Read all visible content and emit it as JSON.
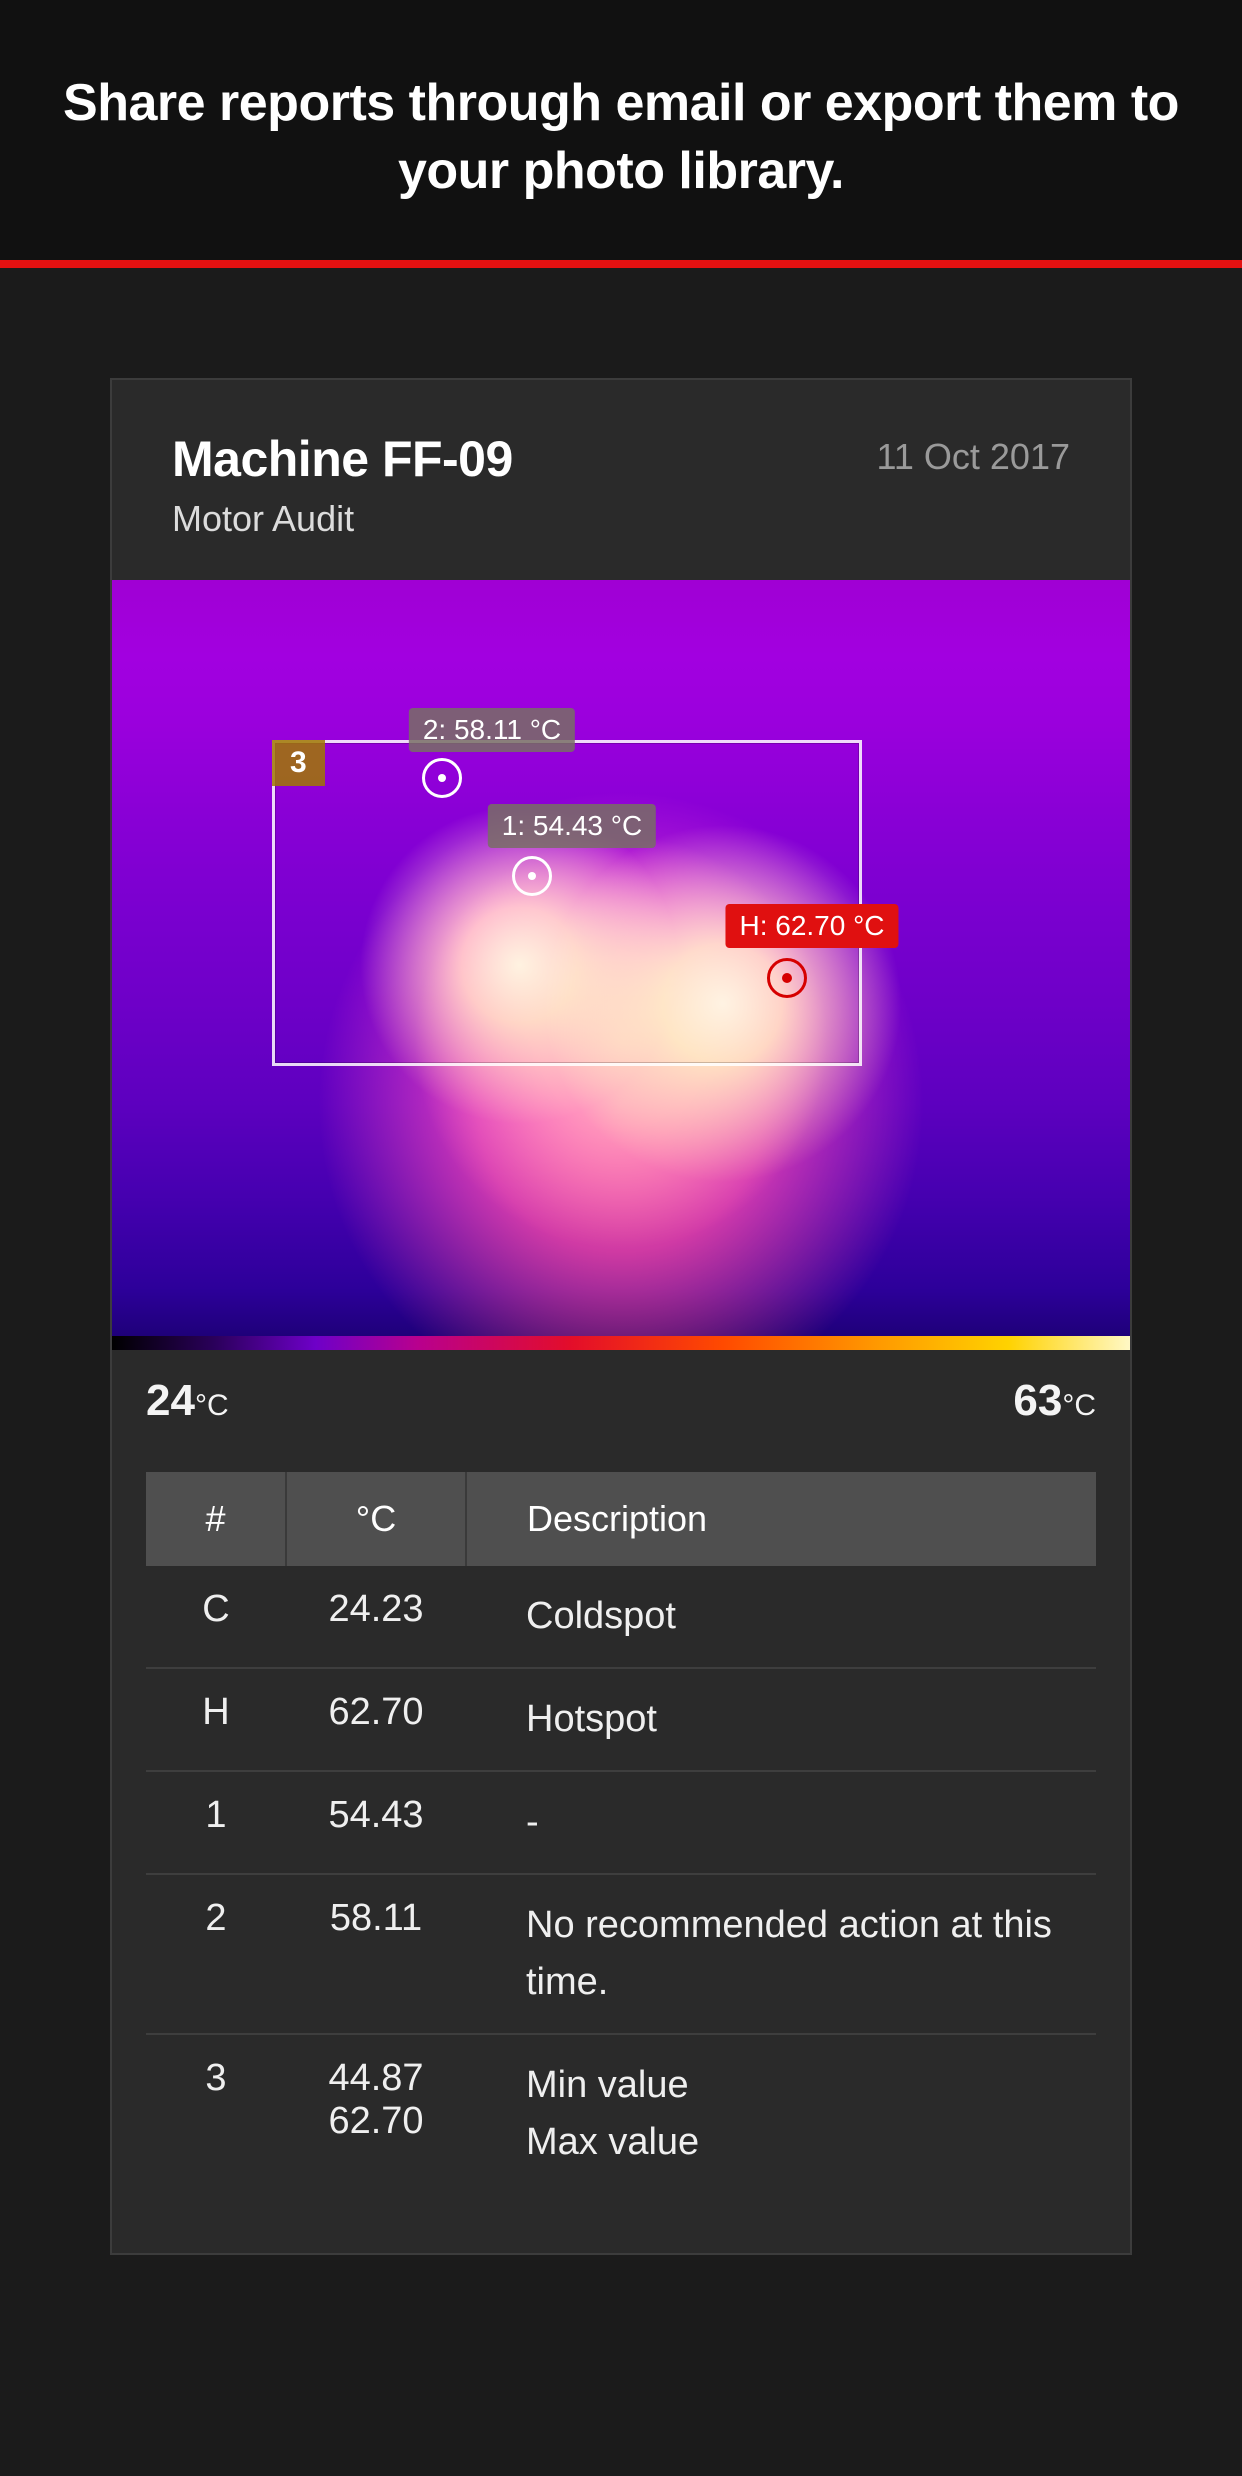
{
  "banner": {
    "headline": "Share reports through email or export them to your photo library."
  },
  "report": {
    "title": "Machine FF-09",
    "subtitle": "Motor Audit",
    "date": "11 Oct 2017"
  },
  "thermal": {
    "roi_label": "3",
    "markers": {
      "m1": "1: 54.43 °C",
      "m2": "2: 58.11 °C",
      "hot": "H: 62.70 °C"
    },
    "scale_min_value": "24",
    "scale_min_unit": "°C",
    "scale_max_value": "63",
    "scale_max_unit": "°C"
  },
  "table": {
    "headers": {
      "id": "#",
      "temp": "°C",
      "desc": "Description"
    },
    "rows": [
      {
        "id": "C",
        "temp": "24.23",
        "desc": "Coldspot"
      },
      {
        "id": "H",
        "temp": "62.70",
        "desc": "Hotspot"
      },
      {
        "id": "1",
        "temp": "54.43",
        "desc": "-"
      },
      {
        "id": "2",
        "temp": "58.11",
        "desc": "No recommended action at this time."
      },
      {
        "id": "3",
        "temp_a": "44.87",
        "temp_b": "62.70",
        "desc_a": "Min value",
        "desc_b": "Max value"
      }
    ]
  }
}
